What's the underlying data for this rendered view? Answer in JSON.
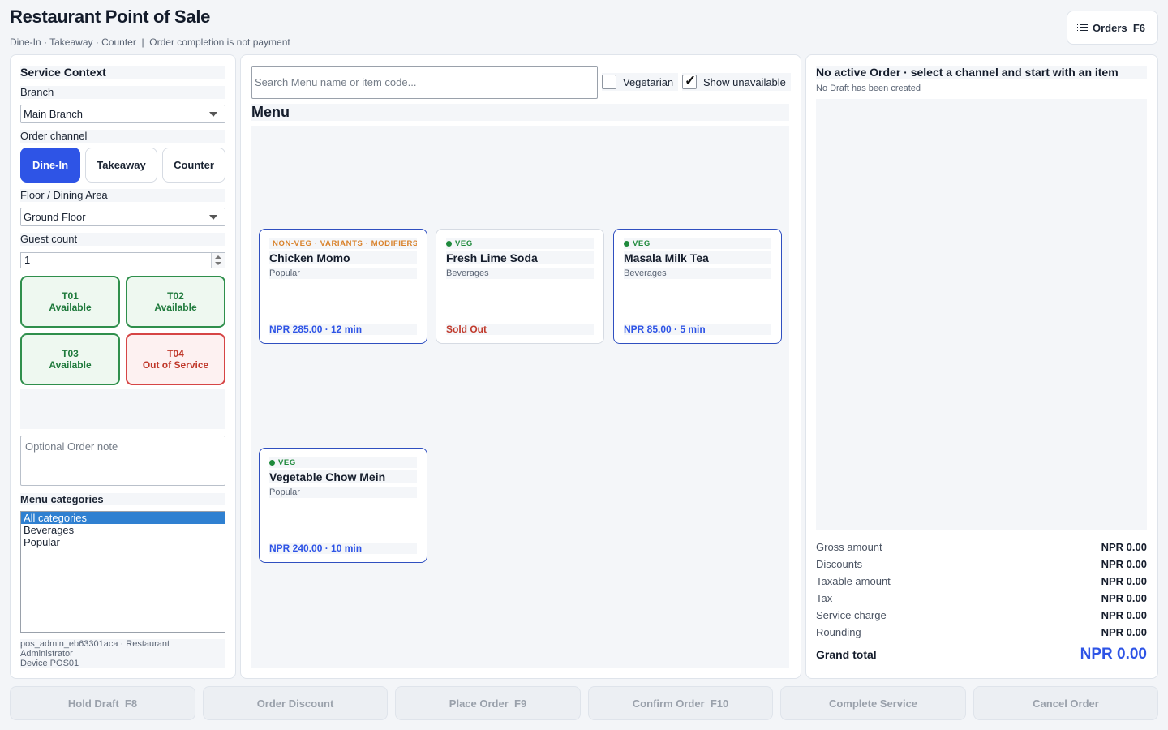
{
  "header": {
    "title": "Restaurant Point of Sale",
    "subtitle": "Dine-In · Takeaway · Counter  |  Order completion is not payment",
    "orders_button": "Orders  F6"
  },
  "service_context": {
    "title": "Service Context",
    "branch_label": "Branch",
    "branch_value": "Main Branch",
    "channel_label": "Order channel",
    "channels": [
      "Dine-In",
      "Takeaway",
      "Counter"
    ],
    "active_channel": "Dine-In",
    "floor_label": "Floor / Dining Area",
    "floor_value": "Ground Floor",
    "guest_label": "Guest count",
    "guest_value": "1",
    "tables": [
      {
        "id": "T01",
        "status": "Available"
      },
      {
        "id": "T02",
        "status": "Available"
      },
      {
        "id": "T03",
        "status": "Available"
      },
      {
        "id": "T04",
        "status": "Out of Service"
      }
    ],
    "note_placeholder": "Optional Order note",
    "categories_label": "Menu categories",
    "categories": [
      "All categories",
      "Beverages",
      "Popular"
    ],
    "selected_category": "All categories",
    "user_line1": "pos_admin_eb63301aca · Restaurant",
    "user_line2": "Administrator",
    "user_line3": "Device POS01"
  },
  "menu": {
    "search_placeholder": "Search Menu name or item code...",
    "vegetarian_label": "Vegetarian",
    "vegetarian_checked": false,
    "show_unavailable_label": "Show unavailable",
    "show_unavailable_checked": true,
    "title": "Menu",
    "items": [
      {
        "tags": "NON-VEG · VARIANTS · MODIFIERS",
        "tag_color": "#d9822b",
        "name": "Chicken Momo",
        "category": "Popular",
        "price": "NPR 285.00 · 12 min"
      },
      {
        "tags": "VEG",
        "tag_color": "#1f8a3c",
        "name": "Fresh Lime Soda",
        "category": "Beverages",
        "price": "Sold Out"
      },
      {
        "tags": "VEG",
        "tag_color": "#1f8a3c",
        "name": "Masala Milk Tea",
        "category": "Beverages",
        "price": "NPR 85.00 · 5 min"
      },
      {
        "tags": "VEG",
        "tag_color": "#1f8a3c",
        "name": "Vegetable Chow Mein",
        "category": "Popular",
        "price": "NPR 240.00 · 10 min"
      }
    ]
  },
  "order": {
    "title": "No active Order · select a channel and start with an item",
    "subtitle": "No Draft has been created",
    "totals": [
      {
        "label": "Gross amount",
        "value": "NPR 0.00"
      },
      {
        "label": "Discounts",
        "value": "NPR 0.00"
      },
      {
        "label": "Taxable amount",
        "value": "NPR 0.00"
      },
      {
        "label": "Tax",
        "value": "NPR 0.00"
      },
      {
        "label": "Service charge",
        "value": "NPR 0.00"
      },
      {
        "label": "Rounding",
        "value": "NPR 0.00"
      }
    ],
    "grand_total_label": "Grand total",
    "grand_total_value": "NPR 0.00"
  },
  "actions": [
    "Hold Draft  F8",
    "Order Discount",
    "Place Order  F9",
    "Confirm Order  F10",
    "Complete Service",
    "Cancel Order"
  ],
  "colors": {
    "accent": "#2e54e6",
    "available": "#1f7a3c",
    "out_of_service": "#c0392b",
    "non_veg": "#d9822b",
    "veg": "#1f8a3c"
  }
}
